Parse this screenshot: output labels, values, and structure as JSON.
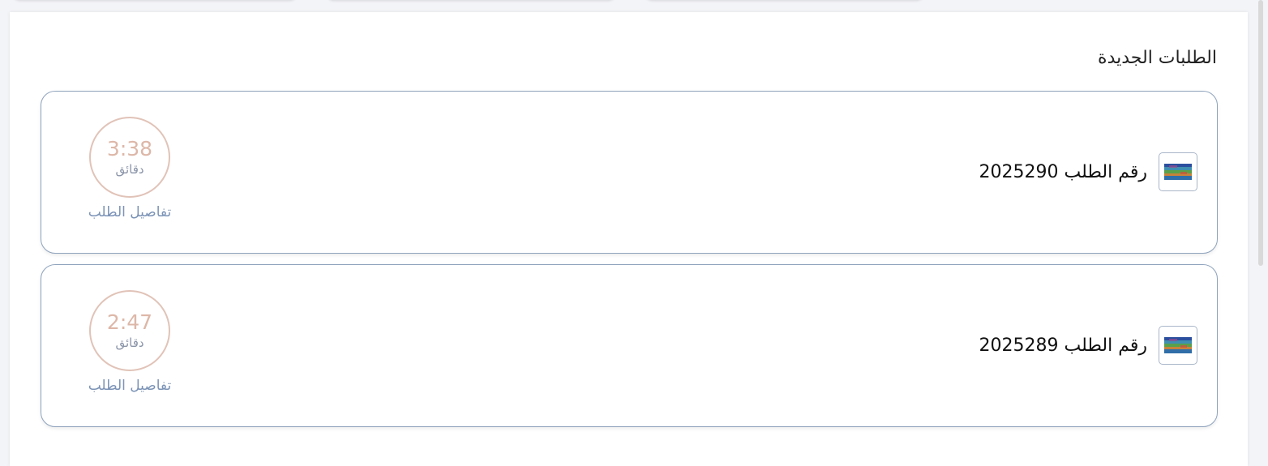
{
  "section": {
    "title": "الطلبات الجديدة"
  },
  "orders": [
    {
      "label": "رقم الطلب 2025290",
      "timer": "3:38",
      "timer_unit": "دقائق",
      "details_label": "تفاصيل الطلب",
      "thumb_icon": "product-thumbnail-icon"
    },
    {
      "label": "رقم الطلب 2025289",
      "timer": "2:47",
      "timer_unit": "دقائق",
      "details_label": "تفاصيل الطلب",
      "thumb_icon": "product-thumbnail-icon"
    }
  ],
  "colors": {
    "card_border": "#8fa3bd",
    "timer_ring": "#e1c3b8",
    "timer_text": "#ddb7a8",
    "link": "#7b93b6"
  }
}
